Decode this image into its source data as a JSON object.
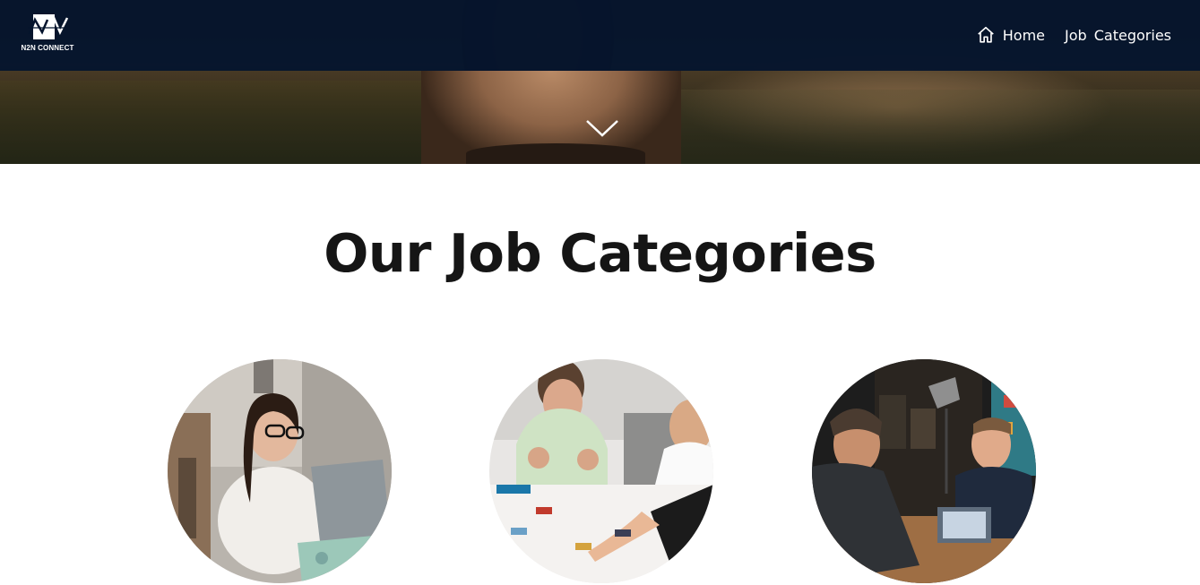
{
  "brand": {
    "logo_text": "N2N CONNECT",
    "logo_icon": "n2n-logo-icon",
    "navbar_color": "#04142d"
  },
  "nav": {
    "items": [
      {
        "label": "Home",
        "icon": "home-icon"
      },
      {
        "label": "Job Categories"
      }
    ]
  },
  "hero": {
    "scroll_icon": "chevron-down-icon"
  },
  "section": {
    "title": "Our Job Categories"
  },
  "categories": [
    {
      "image": "woman-laptop-photo"
    },
    {
      "image": "team-meeting-photo"
    },
    {
      "image": "business-discussion-photo"
    }
  ]
}
